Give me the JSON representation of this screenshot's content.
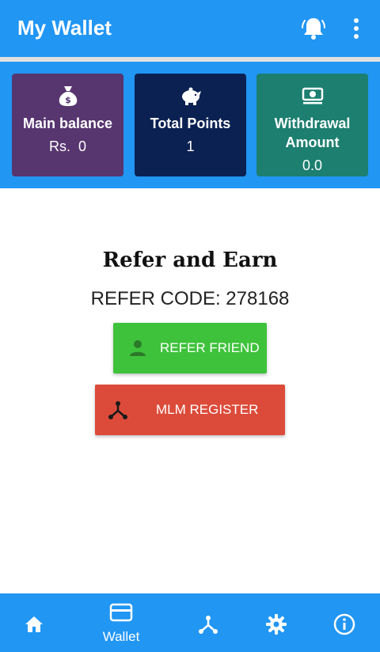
{
  "header": {
    "title": "My Wallet",
    "bell_icon": "bell-icon",
    "menu_icon": "more-vert-icon"
  },
  "cards": [
    {
      "label": "Main balance",
      "value": "Rs.  0",
      "icon": "money-bag-icon",
      "color": "#57356f"
    },
    {
      "label": "Total Points",
      "value": "1",
      "icon": "piggy-bank-icon",
      "color": "#0b2152"
    },
    {
      "label": "Withdrawal Amount",
      "value": "0.0",
      "icon": "money-bill-icon",
      "color": "#1c7f70"
    }
  ],
  "refer": {
    "title": "Refer and Earn",
    "code_label": "REFER CODE:",
    "code_value": "278168",
    "refer_button": "REFER FRIEND",
    "mlm_button": "MLM REGISTER"
  },
  "bottom_nav": {
    "items": [
      {
        "icon": "home-icon",
        "label": ""
      },
      {
        "icon": "credit-card-icon",
        "label": "Wallet"
      },
      {
        "icon": "network-icon",
        "label": ""
      },
      {
        "icon": "gear-icon",
        "label": ""
      },
      {
        "icon": "info-icon",
        "label": ""
      }
    ]
  },
  "colors": {
    "primary": "#2196f3",
    "refer_button": "#3ec23b",
    "mlm_button": "#dc4b3a"
  }
}
